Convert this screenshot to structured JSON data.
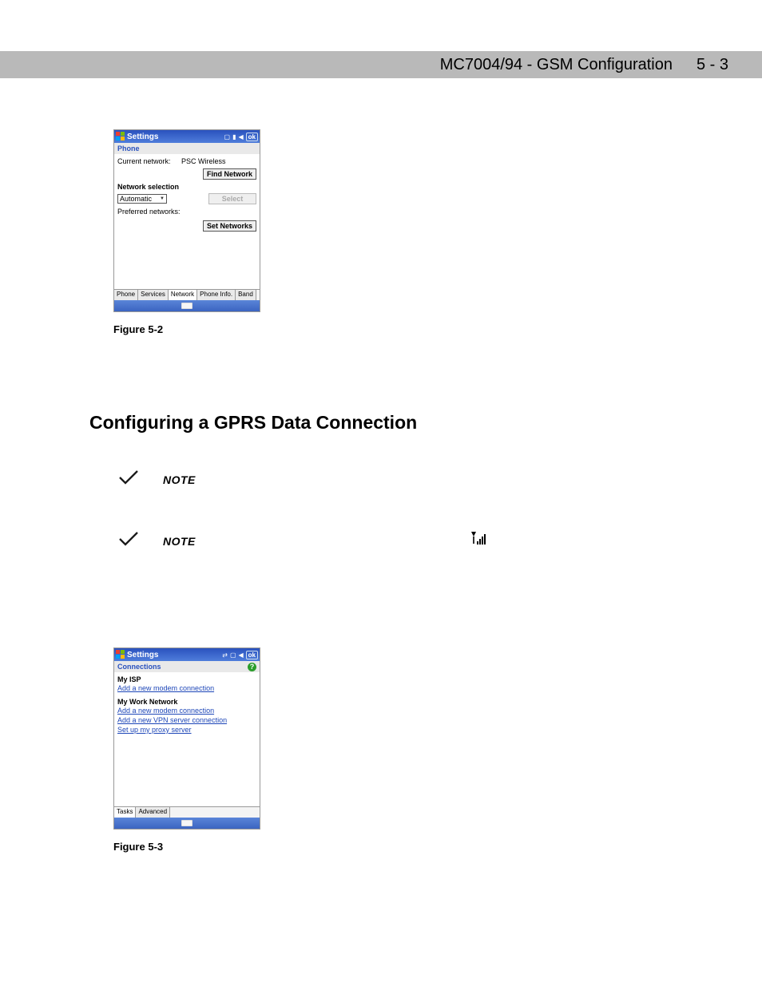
{
  "header": {
    "title": "MC7004/94 - GSM Configuration",
    "page": "5 - 3"
  },
  "fig1": {
    "caption": "Figure 5-2",
    "titlebar": {
      "label": "Settings",
      "ok": "ok"
    },
    "toolbar": "Phone",
    "current_network_label": "Current network:",
    "current_network_value": "PSC Wireless",
    "btn_find": "Find Network",
    "network_selection_label": "Network selection",
    "select_value": "Automatic",
    "btn_select": "Select",
    "preferred_label": "Preferred networks:",
    "btn_set": "Set Networks",
    "tabs": [
      "Phone",
      "Services",
      "Network",
      "Phone Info.",
      "Band"
    ]
  },
  "section_heading": "Configuring a GPRS Data Connection",
  "notes": {
    "label": "NOTE"
  },
  "fig2": {
    "caption": "Figure 5-3",
    "titlebar": {
      "label": "Settings",
      "ok": "ok"
    },
    "toolbar": "Connections",
    "isp_label": "My ISP",
    "isp_link": "Add a new modem connection",
    "work_label": "My Work Network",
    "work_link1": "Add a new modem connection",
    "work_link2": "Add a new VPN server connection",
    "work_link3": "Set up my proxy server",
    "tabs": [
      "Tasks",
      "Advanced"
    ]
  }
}
